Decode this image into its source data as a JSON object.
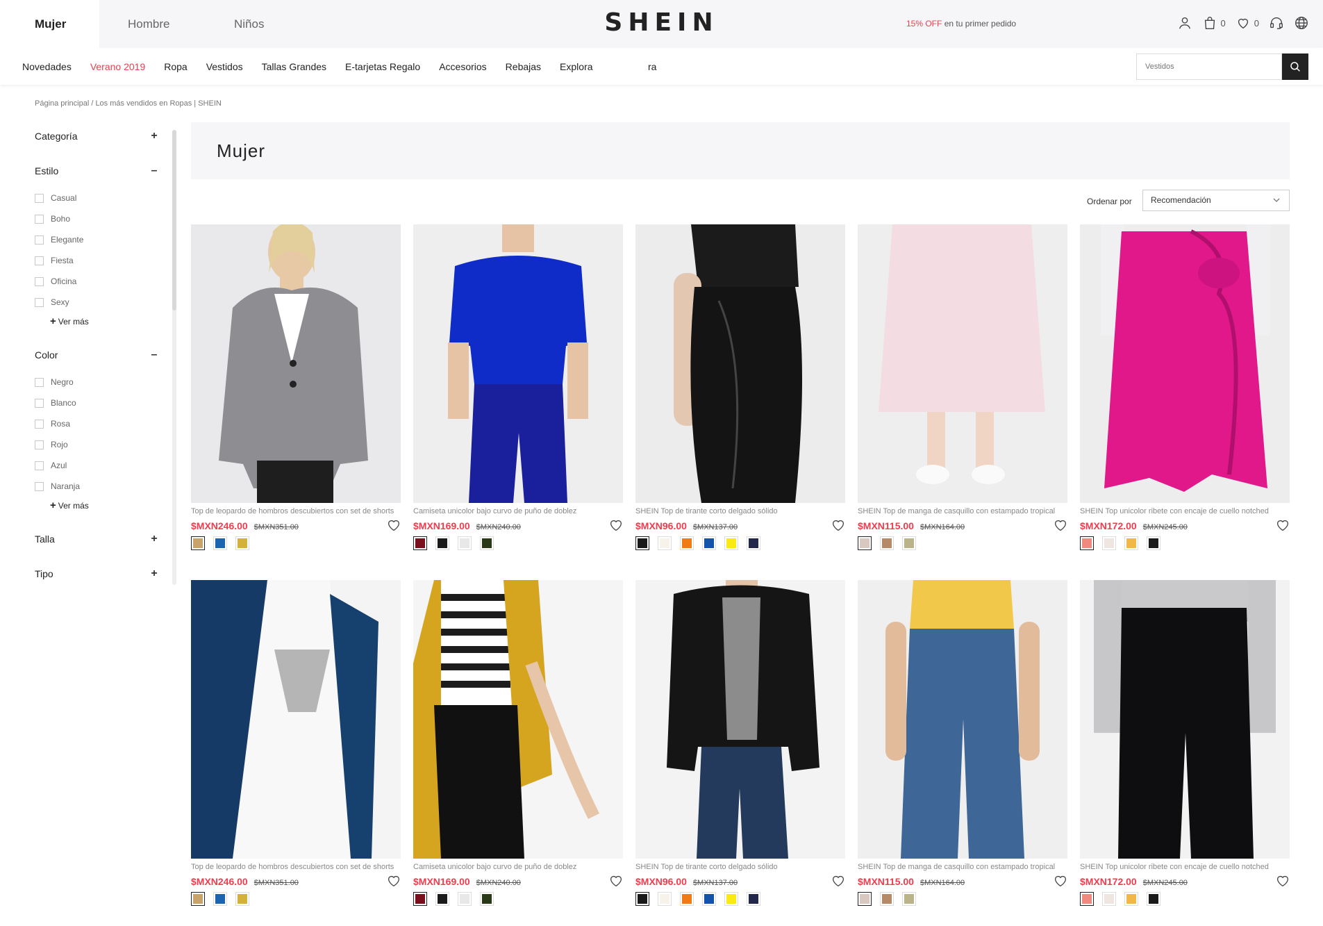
{
  "colors": {
    "accent": "#ee3d4e",
    "dark": "#222222",
    "bg_soft": "#f6f6f8"
  },
  "header": {
    "gender_tabs": [
      "Mujer",
      "Hombre",
      "Niños"
    ],
    "logo": "SHEIN",
    "promo_highlight": "15% OFF",
    "promo_text": " en tu primer pedido",
    "cart_count": "0",
    "wishlist_count": "0",
    "icons": [
      "user-icon",
      "bag-icon",
      "heart-icon",
      "headset-icon",
      "globe-icon"
    ]
  },
  "nav": {
    "links": [
      "Novedades",
      "Verano 2019",
      "Ropa",
      "Vestidos",
      "Tallas Grandes",
      "E-tarjetas Regalo",
      "Accesorios",
      "Rebajas",
      "Explora"
    ],
    "highlighted": "Verano 2019",
    "extra": "ra",
    "search_placeholder": "Vestidos"
  },
  "breadcrumb": "Página principal  /  Los más vendidos en Ropas | SHEIN",
  "sidebar": {
    "categoria": {
      "label": "Categoría",
      "toggle": "+"
    },
    "estilo": {
      "label": "Estilo",
      "toggle": "–",
      "options": [
        "Casual",
        "Boho",
        "Elegante",
        "Fiesta",
        "Oficina",
        "Sexy"
      ],
      "more": "Ver más"
    },
    "color": {
      "label": "Color",
      "toggle": "–",
      "options": [
        "Negro",
        "Blanco",
        "Rosa",
        "Rojo",
        "Azul",
        "Naranja"
      ],
      "more": "Ver más"
    },
    "talla": {
      "label": "Talla",
      "toggle": "+"
    },
    "tipo": {
      "label": "Tipo",
      "toggle": "+"
    }
  },
  "main": {
    "title": "Mujer",
    "sort_label": "Ordenar por",
    "sort_value": "Recomendación"
  },
  "products": [
    {
      "name": "Top de leopardo de hombros descubiertos con set de shorts",
      "price": "$MXN246.00",
      "old_price": "$MXN351.00",
      "swatches": [
        "#c8a46a",
        "#1d64b0",
        "#d2b23a"
      ],
      "photo": "gray-blazer"
    },
    {
      "name": "Camiseta unicolor bajo curvo de puño de doblez",
      "price": "$MXN169.00",
      "old_price": "$MXN240.00",
      "swatches": [
        "#7a0f1e",
        "#1a1a1a",
        "#e8e8e8",
        "#2a3a18"
      ],
      "photo": "blue-tee"
    },
    {
      "name": "SHEIN Top de tirante corto delgado sólido",
      "price": "$MXN96.00",
      "old_price": "$MXN137.00",
      "swatches": [
        "#1a1a1a",
        "#f7f2ea",
        "#f07a15",
        "#1553a8",
        "#f9ea16",
        "#23284a"
      ],
      "photo": "black-skirt"
    },
    {
      "name": "SHEIN Top de manga de casquillo con estampado tropical",
      "price": "$MXN115.00",
      "old_price": "$MXN164.00",
      "swatches": [
        "#d8c8c0",
        "#b48a68",
        "#b9b48a"
      ],
      "photo": "pink-skirt"
    },
    {
      "name": "SHEIN Top unicolor ribete con encaje de cuello notched",
      "price": "$MXN172.00",
      "old_price": "$MXN245.00",
      "swatches": [
        "#f08a80",
        "#efe6e2",
        "#f0b848",
        "#1a1a1a"
      ],
      "photo": "magenta-skirt"
    },
    {
      "name": "Top de leopardo de hombros descubiertos con set de shorts",
      "price": "$MXN246.00",
      "old_price": "$MXN351.00",
      "swatches": [
        "#c8a46a",
        "#1d64b0",
        "#d2b23a"
      ],
      "photo": "navy-blazer"
    },
    {
      "name": "Camiseta unicolor bajo curvo de puño de doblez",
      "price": "$MXN169.00",
      "old_price": "$MXN240.00",
      "swatches": [
        "#7a0f1e",
        "#1a1a1a",
        "#e8e8e8",
        "#2a3a18"
      ],
      "photo": "mustard-blazer"
    },
    {
      "name": "SHEIN Top de tirante corto delgado sólido",
      "price": "$MXN96.00",
      "old_price": "$MXN137.00",
      "swatches": [
        "#1a1a1a",
        "#f7f2ea",
        "#f07a15",
        "#1553a8",
        "#f9ea16",
        "#23284a"
      ],
      "photo": "black-blazer"
    },
    {
      "name": "SHEIN Top de manga de casquillo con estampado tropical",
      "price": "$MXN115.00",
      "old_price": "$MXN164.00",
      "swatches": [
        "#d8c8c0",
        "#b48a68",
        "#b9b48a"
      ],
      "photo": "blue-jeans"
    },
    {
      "name": "SHEIN Top unicolor ribete con encaje de cuello notched",
      "price": "$MXN172.00",
      "old_price": "$MXN245.00",
      "swatches": [
        "#f08a80",
        "#efe6e2",
        "#f0b848",
        "#1a1a1a"
      ],
      "photo": "black-jeans"
    }
  ]
}
